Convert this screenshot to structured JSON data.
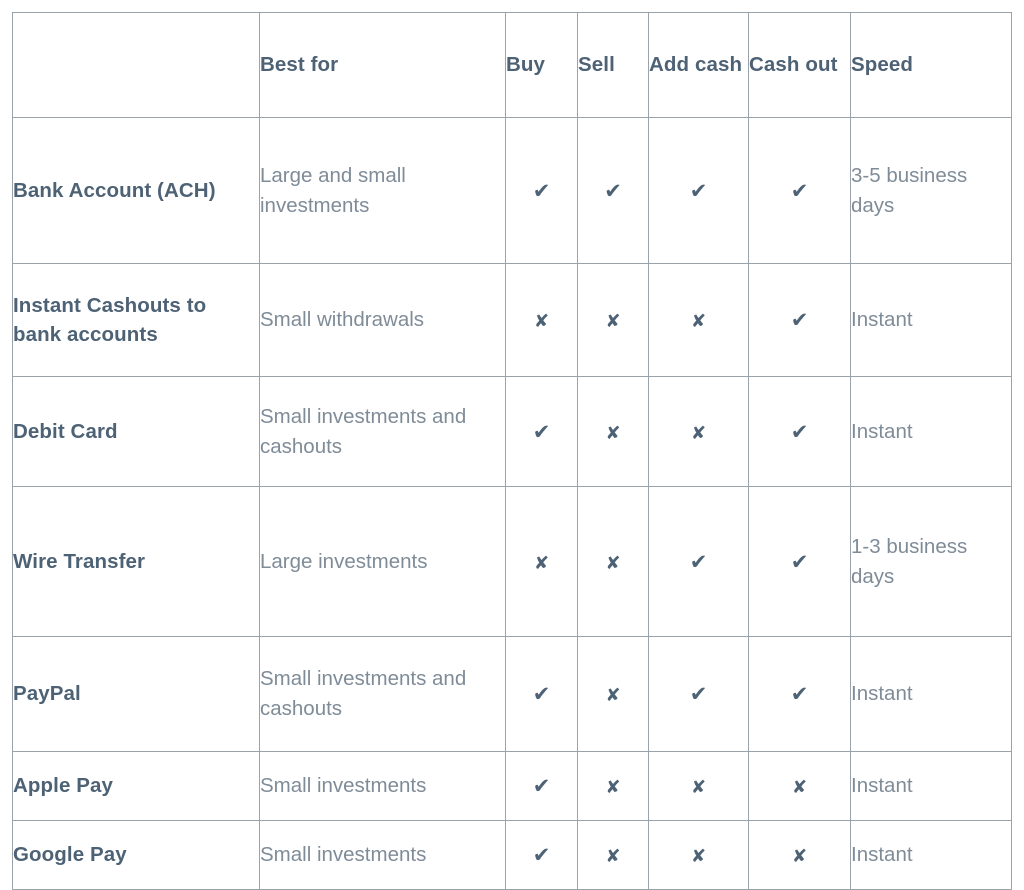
{
  "table": {
    "columns": [
      {
        "key": "method",
        "label": ""
      },
      {
        "key": "bestfor",
        "label": "Best for"
      },
      {
        "key": "buy",
        "label": "Buy"
      },
      {
        "key": "sell",
        "label": "Sell"
      },
      {
        "key": "addcash",
        "label": "Add cash"
      },
      {
        "key": "cashout",
        "label": "Cash out"
      },
      {
        "key": "speed",
        "label": "Speed"
      }
    ],
    "headers": {
      "blank": "",
      "best_for": "Best for",
      "buy": "Buy",
      "sell": "Sell",
      "add_cash": "Add cash",
      "cash_out": "Cash out",
      "speed": "Speed"
    },
    "glyphs": {
      "yes": "✔",
      "no": "✘"
    },
    "colors": {
      "heading_text": "#4e6275",
      "body_text": "#7f8c98",
      "border": "#9aa3ab",
      "background": "#ffffff",
      "paypal_link": "#3b3bef"
    },
    "rows": [
      {
        "method": "Bank Account (ACH)",
        "method_line1": "Bank Account",
        "method_line2": "(ACH)",
        "best_for": "Large and small investments",
        "best_for_line1": "Large and small",
        "best_for_line2": "investments",
        "buy": "✔",
        "sell": "✔",
        "add_cash": "✔",
        "cash_out": "✔",
        "speed": "3-5 business days",
        "speed_line1": "3-5",
        "speed_line2": "business",
        "speed_line3": "days",
        "highlight": false
      },
      {
        "method": "Instant Cashouts to bank accounts",
        "method_line1": "Instant Cashouts",
        "method_line2": "to bank accounts",
        "best_for": "Small withdrawals",
        "best_for_line1": "Small withdrawals",
        "best_for_line2": "",
        "buy": "✘",
        "sell": "✘",
        "add_cash": "✘",
        "cash_out": "✔",
        "speed": "Instant",
        "highlight": false
      },
      {
        "method": "Debit Card",
        "method_line1": "Debit Card",
        "method_line2": "",
        "best_for": "Small investments and cashouts",
        "best_for_line1": "Small investments",
        "best_for_line2": "and cashouts",
        "buy": "✔",
        "sell": "✘",
        "add_cash": "✘",
        "cash_out": "✔",
        "speed": "Instant",
        "highlight": false
      },
      {
        "method": "Wire Transfer",
        "method_line1": "Wire Transfer",
        "method_line2": "",
        "best_for": "Large investments",
        "best_for_line1": "Large investments",
        "best_for_line2": "",
        "buy": "✘",
        "sell": "✘",
        "add_cash": "✔",
        "cash_out": "✔",
        "speed": "1-3 business days",
        "speed_line1": "1-3",
        "speed_line2": "business",
        "speed_line3": "days",
        "highlight": false
      },
      {
        "method": "PayPal",
        "method_line1": "PayPal",
        "method_line2": "",
        "best_for": "Small investments and cashouts",
        "best_for_line1": "Small investments",
        "best_for_line2": "and cashouts",
        "buy": "✔",
        "sell": "✘",
        "add_cash": "✔",
        "cash_out": "✔",
        "speed": "Instant",
        "highlight": true
      },
      {
        "method": "Apple Pay",
        "method_line1": "Apple Pay",
        "method_line2": "",
        "best_for": "Small investments",
        "best_for_line1": "Small investments",
        "best_for_line2": "",
        "buy": "✔",
        "sell": "✘",
        "add_cash": "✘",
        "cash_out": "✘",
        "speed": "Instant",
        "highlight": false
      },
      {
        "method": "Google Pay",
        "method_line1": "Google Pay",
        "method_line2": "",
        "best_for": "Small investments",
        "best_for_line1": "Small investments",
        "best_for_line2": "",
        "buy": "✔",
        "sell": "✘",
        "add_cash": "✘",
        "cash_out": "✘",
        "speed": "Instant",
        "highlight": false
      }
    ]
  }
}
